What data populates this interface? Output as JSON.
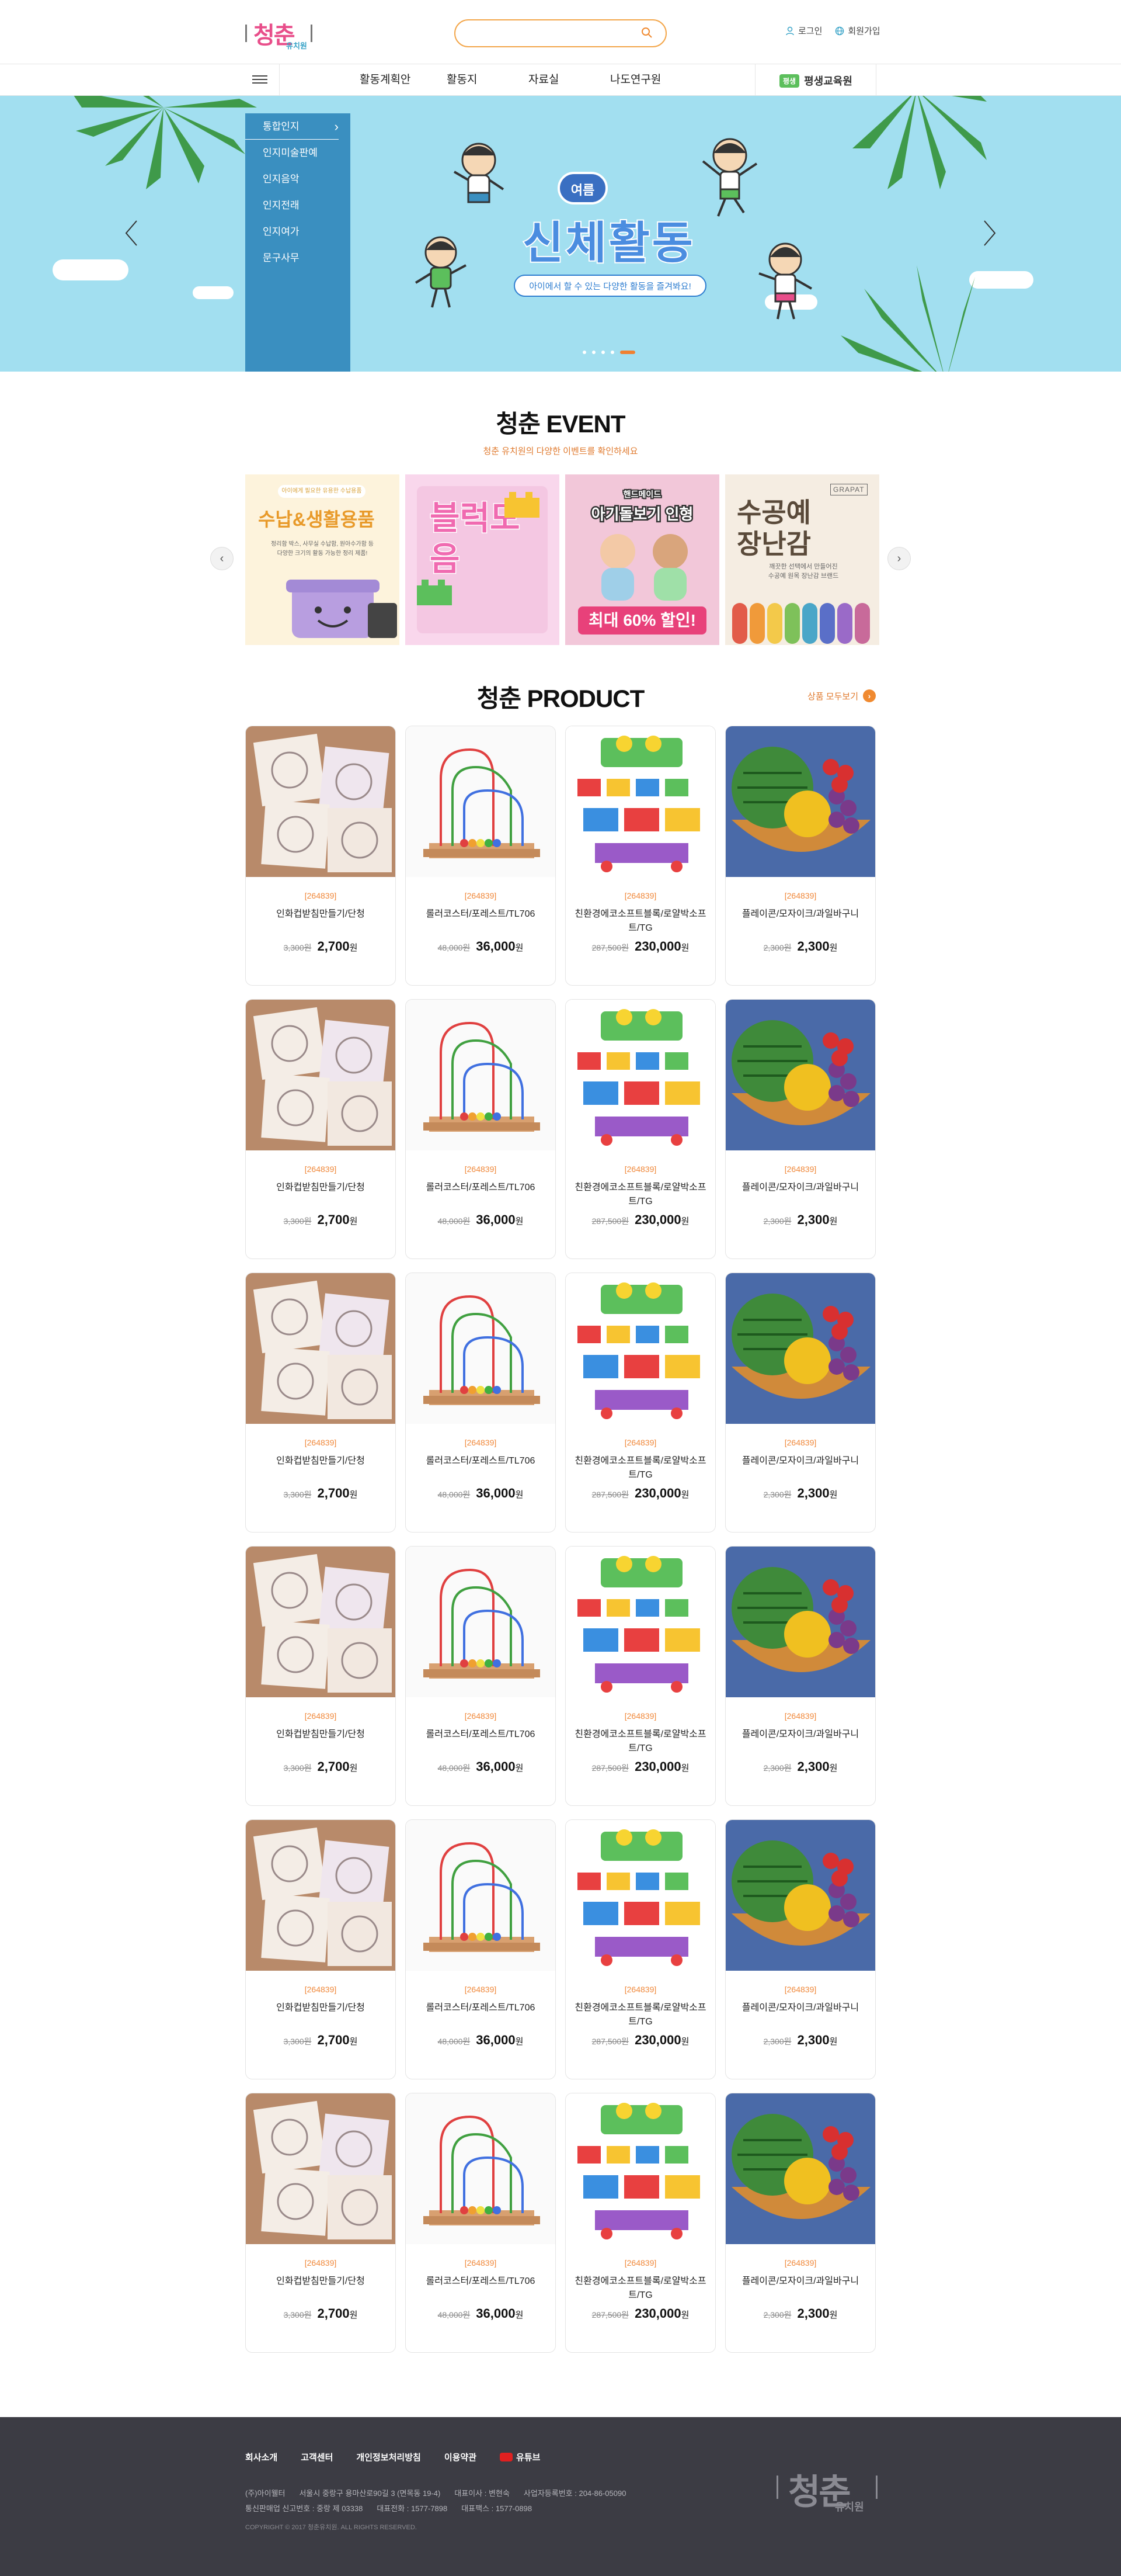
{
  "header": {
    "logo_text": "청춘",
    "logo_sub": "유치원",
    "search_placeholder": "",
    "login": "로그인",
    "join": "회원가입"
  },
  "nav": {
    "items": [
      "활동계획안",
      "활동지",
      "자료실",
      "나도연구원"
    ],
    "lifelong_badge": "평생",
    "lifelong": "평생교육원"
  },
  "hero": {
    "side_menu": [
      "통합인지",
      "인지미술판예",
      "인지음악",
      "인지전래",
      "인지여가",
      "문구사무"
    ],
    "badge": "여름",
    "title": "신체활동",
    "subtitle": "아이에서 할 수 있는 다양한 활동을 즐겨봐요!",
    "slide_count": 5,
    "active_slide": 5
  },
  "event": {
    "title": "청춘 EVENT",
    "subtitle": "청춘 유치원의 다양한 이벤트를 확인하세요",
    "banners": [
      {
        "top": "아이에게 필요한 유용한 수납용품",
        "title": "수납&생활용품",
        "desc": "정리함 박스, 사무실 수납함, 원아수가함 등\n다양한 크기의 활동 가능한 정리 제품!"
      },
      {
        "title": "블럭모음"
      },
      {
        "top": "핸드메이드",
        "title": "아기돌보기 인형",
        "promo": "최대 60% 할인!"
      },
      {
        "brand": "GRAPAT",
        "title": "수공예장난감",
        "desc": "깨끗한 선택에서 만들어진\n수공예 원목 장난감 브랜드"
      }
    ]
  },
  "product": {
    "title": "청춘 PRODUCT",
    "more": "상품 모두보기",
    "items": [
      {
        "code": "[264839]",
        "name": "인화컵받침만들기/단청",
        "old": "3,300원",
        "price": "2,700",
        "unit": "원"
      },
      {
        "code": "[264839]",
        "name": "롤러코스터/포레스트/TL706",
        "old": "48,000원",
        "price": "36,000",
        "unit": "원"
      },
      {
        "code": "[264839]",
        "name": "친환경에코소프트블록/로얄박소프트/TG",
        "old": "287,500원",
        "price": "230,000",
        "unit": "원"
      },
      {
        "code": "[264839]",
        "name": "플레이콘/모자이크/과일바구니",
        "old": "2,300원",
        "price": "2,300",
        "unit": "원"
      }
    ]
  },
  "footer": {
    "links": [
      "회사소개",
      "고객센터",
      "개인정보처리방침",
      "이용약관",
      "유튜브"
    ],
    "address": "(주)아이웰터",
    "address2": "서울시 중랑구 용마산로90길 3 (면목동 19-4)",
    "ceo": "대표이사 : 변현숙",
    "bizno": "사업자등록번호 : 204-86-05090",
    "mail": "통신판매업 신고번호 : 중랑 제 03338",
    "tel": "대표전화 : 1577-7898",
    "fax": "대표팩스 : 1577-0898",
    "copy": "COPYRIGHT © 2017 청춘유치원. ALL RIGHTS RESERVED."
  }
}
